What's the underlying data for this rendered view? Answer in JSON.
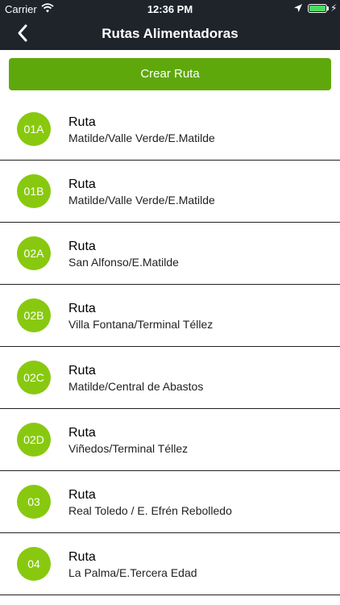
{
  "status_bar": {
    "carrier": "Carrier",
    "time": "12:36 PM",
    "battery_level": 1.0
  },
  "nav": {
    "title": "Rutas Alimentadoras",
    "back_icon": "chevron-left-icon"
  },
  "create_button": {
    "label": "Crear Ruta"
  },
  "colors": {
    "header_bg": "#1f232a",
    "button_bg": "#5fa80c",
    "badge_bg": "#88c90f"
  },
  "routes": [
    {
      "code": "01A",
      "name": "Ruta",
      "description": "Matilde/Valle Verde/E.Matilde"
    },
    {
      "code": "01B",
      "name": "Ruta",
      "description": "Matilde/Valle Verde/E.Matilde"
    },
    {
      "code": "02A",
      "name": "Ruta",
      "description": "San Alfonso/E.Matilde"
    },
    {
      "code": "02B",
      "name": "Ruta",
      "description": "Villa Fontana/Terminal Téllez"
    },
    {
      "code": "02C",
      "name": "Ruta",
      "description": "Matilde/Central de Abastos"
    },
    {
      "code": "02D",
      "name": "Ruta",
      "description": "Viñedos/Terminal Téllez"
    },
    {
      "code": "03",
      "name": "Ruta",
      "description": "Real Toledo / E. Efrén Rebolledo"
    },
    {
      "code": "04",
      "name": "Ruta",
      "description": "La Palma/E.Tercera Edad"
    }
  ]
}
